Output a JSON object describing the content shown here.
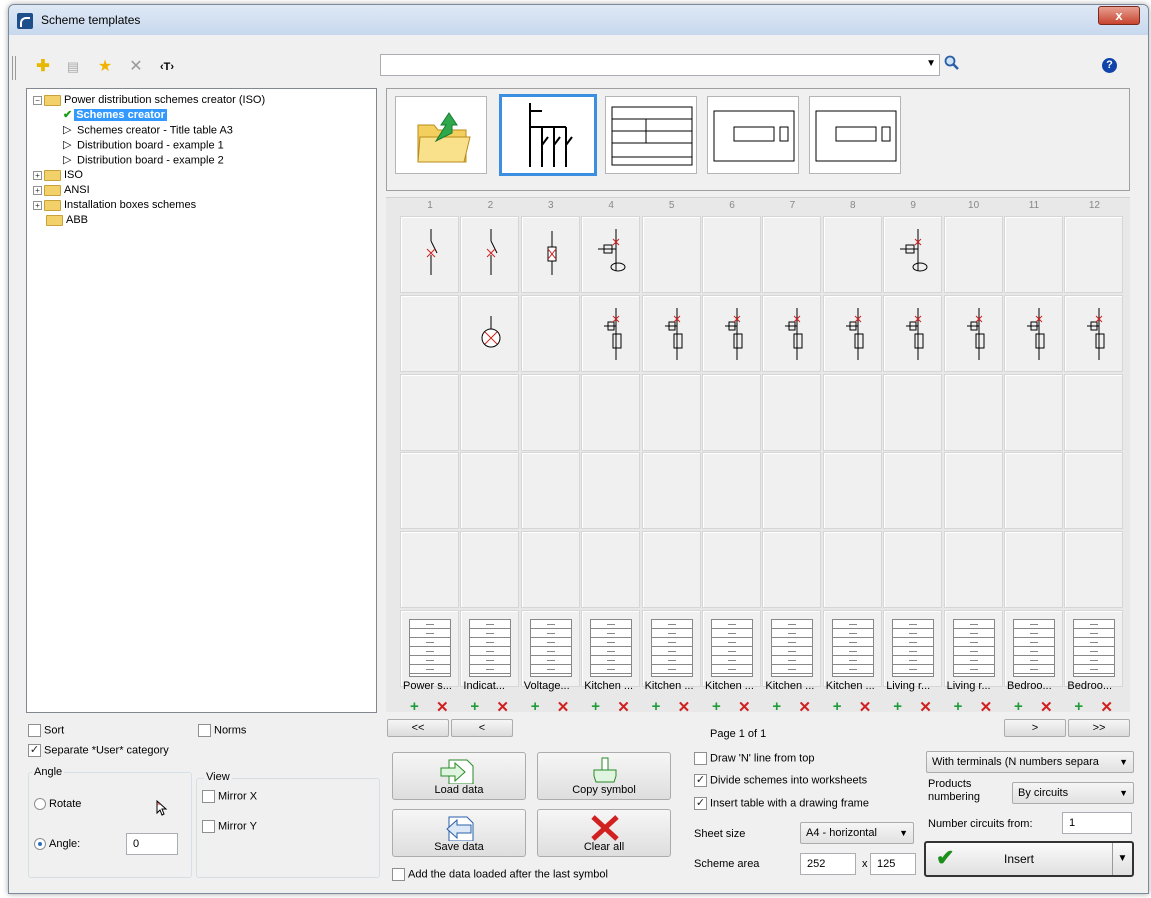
{
  "window": {
    "title": "Scheme templates",
    "close": "x"
  },
  "toolbar": {
    "add_icon": "✚",
    "props_icon": "▤",
    "fav_icon": "★",
    "delete_icon": "✕",
    "text_icon": "‹T›"
  },
  "search": {
    "value": ""
  },
  "tree": {
    "root": "Power distribution schemes creator (ISO)",
    "children": [
      "Schemes creator",
      "Schemes creator - Title table A3",
      "Distribution board - example 1",
      "Distribution board - example 2"
    ],
    "folders": [
      "ISO",
      "ANSI",
      "Installation boxes schemes",
      "ABB"
    ]
  },
  "grid": {
    "columns": [
      "1",
      "2",
      "3",
      "4",
      "5",
      "6",
      "7",
      "8",
      "9",
      "10",
      "11",
      "12"
    ],
    "labels": [
      "Power s...",
      "Indicat...",
      "Voltage...",
      "Kitchen ...",
      "Kitchen ...",
      "Kitchen ...",
      "Kitchen ...",
      "Kitchen ...",
      "Living r...",
      "Living r...",
      "Bedroo...",
      "Bedroo..."
    ],
    "add": "+",
    "remove": "✕"
  },
  "pager": {
    "first": "<<",
    "prev": "<",
    "next": ">",
    "last": ">>",
    "page": "Page 1 of 1"
  },
  "options": {
    "sort": "Sort",
    "norms": "Norms",
    "separate_user": "Separate *User* category",
    "angle_group": "Angle",
    "view_group": "View",
    "rotate": "Rotate",
    "angle": "Angle:",
    "angle_value": "0",
    "mirror_x": "Mirror X",
    "mirror_y": "Mirror Y"
  },
  "buttons": {
    "load": "Load data",
    "copy": "Copy symbol",
    "save": "Save data",
    "clear": "Clear all",
    "insert": "Insert"
  },
  "add_after_last": "Add the data loaded after the last symbol",
  "draw_n_line": "Draw 'N' line from top",
  "divide_worksheets": "Divide schemes into worksheets",
  "insert_table": "Insert table with a drawing frame",
  "sheet_size_label": "Sheet size",
  "sheet_size": "A4 - horizontal",
  "scheme_area_label": "Scheme area",
  "scheme_area_w": "252",
  "scheme_area_x": "x",
  "scheme_area_h": "125",
  "terminals": "With terminals (N numbers separa",
  "products_numbering_label": "Products numbering",
  "products_numbering": "By circuits",
  "number_circuits_label": "Number circuits from:",
  "number_circuits": "1",
  "colors": {
    "selection": "#3399ff",
    "add": "#1f9d3a",
    "remove": "#d02020"
  }
}
